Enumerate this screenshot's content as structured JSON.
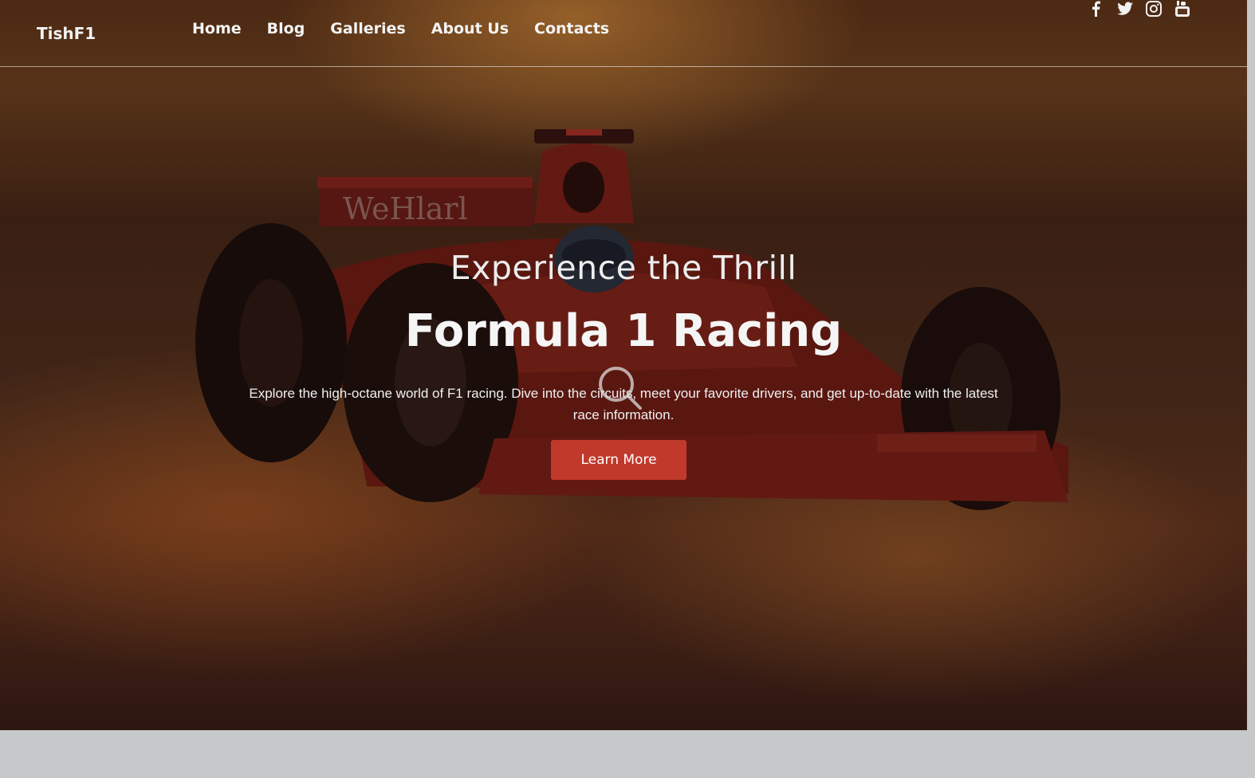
{
  "header": {
    "brand": "TishF1",
    "nav": [
      "Home",
      "Blog",
      "Galleries",
      "About Us",
      "Contacts"
    ],
    "social_icons": [
      "facebook-icon",
      "twitter-icon",
      "instagram-icon",
      "youtube-icon"
    ]
  },
  "hero": {
    "subtitle": "Experience the Thrill",
    "title": "Formula 1 Racing",
    "description": "Explore the high-octane world of F1 racing. Dive into the circuits, meet your favorite drivers, and get up-to-date with the latest race information.",
    "cta_label": "Learn More",
    "cta_color": "#c0392b",
    "background_image": "formula-1-car-on-wet-track-at-sunset"
  }
}
